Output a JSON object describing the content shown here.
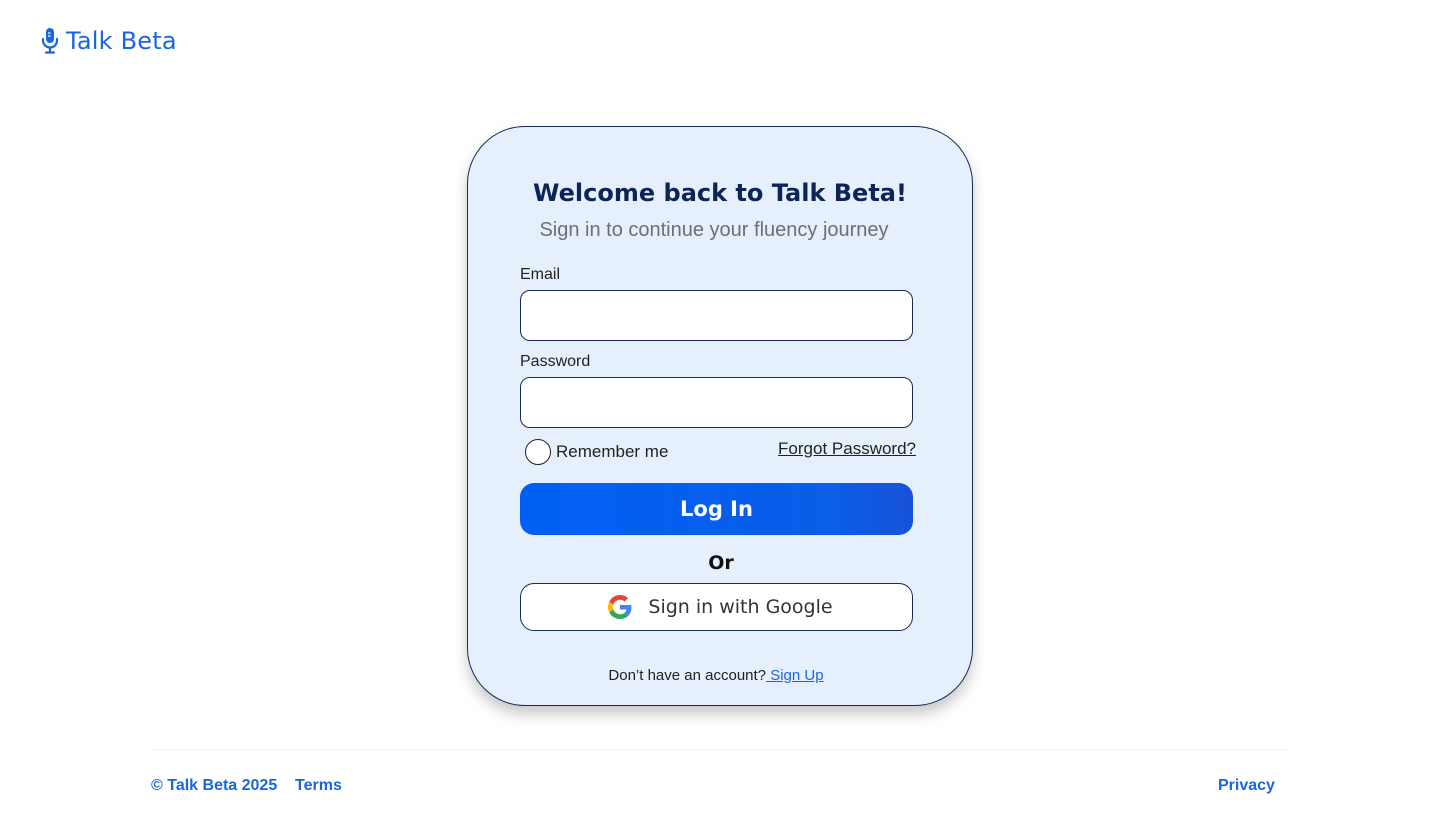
{
  "brand": {
    "name": "Talk Beta",
    "icon": "microphone-icon",
    "color": "#1a66e0"
  },
  "login": {
    "title": "Welcome back to Talk Beta!",
    "subtitle": "Sign in to continue your fluency journey",
    "email_label": "Email",
    "email_value": "",
    "email_placeholder": "",
    "password_label": "Password",
    "password_value": "",
    "password_placeholder": "",
    "remember_label": "Remember me",
    "remember_checked": false,
    "forgot_label": "Forgot Password?",
    "login_button": "Log In",
    "or_text": "Or",
    "google_button": "Sign in with Google",
    "google_icon": "google-icon",
    "signup_prompt": "Don’t have an account?",
    "signup_link": " Sign Up"
  },
  "footer": {
    "copyright": "© Talk Beta 2025",
    "terms": "Terms",
    "privacy": "Privacy"
  },
  "colors": {
    "accent": "#0060f5",
    "card_background": "#e6f0fc",
    "title_color": "#0d2457",
    "border": "#1b2a55"
  }
}
